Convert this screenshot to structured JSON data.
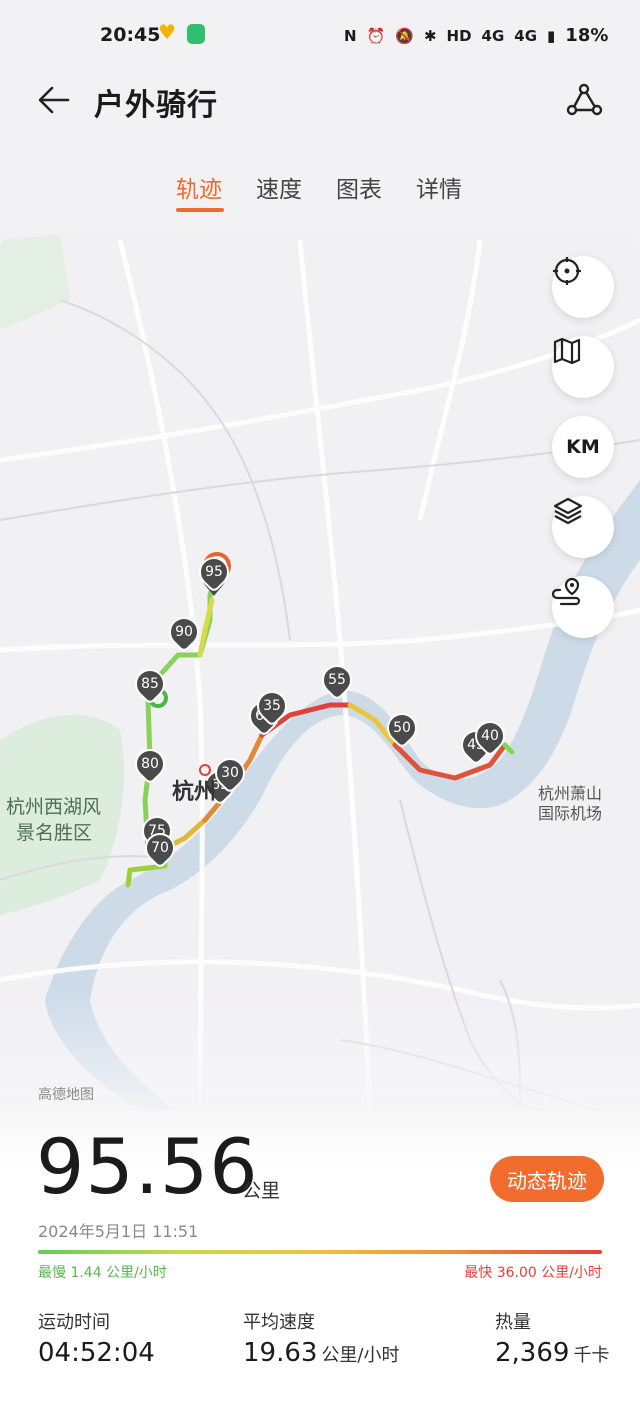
{
  "status_bar": {
    "time": "20:45",
    "network": "4G",
    "network2": "4G",
    "hd": "HD",
    "battery": "18%"
  },
  "header": {
    "title": "户外骑行",
    "back_icon": "arrow-left-icon",
    "share_icon": "route-share-icon"
  },
  "tabs": [
    {
      "label": "轨迹",
      "active": true
    },
    {
      "label": "速度",
      "active": false
    },
    {
      "label": "图表",
      "active": false
    },
    {
      "label": "详情",
      "active": false
    }
  ],
  "map": {
    "labels": {
      "city": "杭州",
      "westlake_1": "杭州西湖风",
      "westlake_2": "景名胜区",
      "airport_1": "杭州萧山",
      "airport_2": "国际机场"
    },
    "provider": "高德地图",
    "controls": [
      {
        "name": "locate",
        "icon": "crosshair-icon"
      },
      {
        "name": "map-type",
        "icon": "map-icon"
      },
      {
        "name": "unit",
        "label": "KM"
      },
      {
        "name": "layers",
        "icon": "layers-icon"
      },
      {
        "name": "route",
        "icon": "route-pin-icon"
      }
    ],
    "km_markers": [
      "95",
      "90",
      "85",
      "80",
      "75",
      "70",
      "65",
      "60",
      "55",
      "50",
      "45",
      "40",
      "35",
      "30"
    ]
  },
  "summary": {
    "distance": "95.56",
    "distance_unit": "公里",
    "dynamic_track_button": "动态轨迹",
    "date": "2024年5月1日 11:51",
    "slowest": "最慢 1.44 公里/小时",
    "fastest": "最快 36.00 公里/小时",
    "speed_gradient": [
      "#5fcf5a",
      "#c8d94a",
      "#f2c03a",
      "#f08a36",
      "#e0423a"
    ]
  },
  "stats": [
    {
      "label": "运动时间",
      "value": "04:52:04",
      "unit": ""
    },
    {
      "label": "平均速度",
      "value": "19.63",
      "unit": "公里/小时"
    },
    {
      "label": "热量",
      "value": "2,369",
      "unit": "千卡"
    }
  ]
}
